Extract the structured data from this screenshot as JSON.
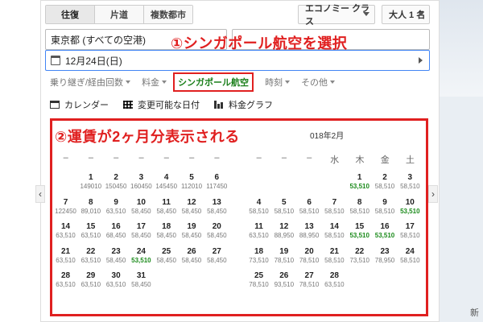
{
  "trip_tabs": [
    "往復",
    "片道",
    "複数都市"
  ],
  "cabin": "エコノミー クラス",
  "passengers": "大人 1 名",
  "origin": "東京都 (すべての空港)",
  "date": "12月24日(日)",
  "filters": [
    "乗り継ぎ/経由回数",
    "料金",
    "シンガポール航空",
    "時刻",
    "その他"
  ],
  "views": [
    "カレンダー",
    "変更可能な日付",
    "料金グラフ"
  ],
  "annotations": {
    "step1": "①シンガポール航空を選択",
    "step2": "②運賃が2ヶ月分表示される"
  },
  "calendar": {
    "right_month": "018年2月",
    "right_dow": [
      "水",
      "木",
      "金",
      "土"
    ],
    "left_days": [
      {
        "d": "1",
        "p": "149010"
      },
      {
        "d": "2",
        "p": "150450"
      },
      {
        "d": "3",
        "p": "160450"
      },
      {
        "d": "4",
        "p": "145450"
      },
      {
        "d": "5",
        "p": "112010"
      },
      {
        "d": "6",
        "p": "117450"
      },
      {
        "d": "7",
        "p": "122450"
      },
      {
        "d": "8",
        "p": "89,010"
      },
      {
        "d": "9",
        "p": "63,510"
      },
      {
        "d": "10",
        "p": "58,450"
      },
      {
        "d": "11",
        "p": "58,450"
      },
      {
        "d": "12",
        "p": "58,450"
      },
      {
        "d": "13",
        "p": "58,450"
      },
      {
        "d": "14",
        "p": "63,510"
      },
      {
        "d": "15",
        "p": "63,510"
      },
      {
        "d": "16",
        "p": "68,450"
      },
      {
        "d": "17",
        "p": "58,450"
      },
      {
        "d": "18",
        "p": "58,450"
      },
      {
        "d": "19",
        "p": "58,450"
      },
      {
        "d": "20",
        "p": "58,450"
      },
      {
        "d": "21",
        "p": "63,510"
      },
      {
        "d": "22",
        "p": "63,510"
      },
      {
        "d": "23",
        "p": "58,450"
      },
      {
        "d": "24",
        "p": "53,510",
        "low": true
      },
      {
        "d": "25",
        "p": "58,450"
      },
      {
        "d": "26",
        "p": "58,450"
      },
      {
        "d": "27",
        "p": "58,450"
      },
      {
        "d": "28",
        "p": "63,510"
      },
      {
        "d": "29",
        "p": "63,510"
      },
      {
        "d": "30",
        "p": "63,510"
      },
      {
        "d": "31",
        "p": "58,450"
      }
    ],
    "right_days": [
      {
        "d": "1",
        "p": "53,510",
        "low": true
      },
      {
        "d": "2",
        "p": "58,510"
      },
      {
        "d": "3",
        "p": "58,510"
      },
      {
        "d": "4",
        "p": "58,510"
      },
      {
        "d": "5",
        "p": "58,510"
      },
      {
        "d": "6",
        "p": "58,510"
      },
      {
        "d": "7",
        "p": "58,510"
      },
      {
        "d": "8",
        "p": "58,510"
      },
      {
        "d": "9",
        "p": "58,510"
      },
      {
        "d": "10",
        "p": "53,510",
        "low": true
      },
      {
        "d": "11",
        "p": "63,510"
      },
      {
        "d": "12",
        "p": "88,950"
      },
      {
        "d": "13",
        "p": "88,950"
      },
      {
        "d": "14",
        "p": "58,510"
      },
      {
        "d": "15",
        "p": "53,510",
        "low": true
      },
      {
        "d": "16",
        "p": "53,510",
        "low": true
      },
      {
        "d": "17",
        "p": "58,510"
      },
      {
        "d": "18",
        "p": "73,510"
      },
      {
        "d": "19",
        "p": "78,510"
      },
      {
        "d": "20",
        "p": "78,510"
      },
      {
        "d": "21",
        "p": "58,510"
      },
      {
        "d": "22",
        "p": "73,510"
      },
      {
        "d": "23",
        "p": "78,950"
      },
      {
        "d": "24",
        "p": "58,510"
      },
      {
        "d": "25",
        "p": "78,510"
      },
      {
        "d": "26",
        "p": "93,510"
      },
      {
        "d": "27",
        "p": "78,510"
      },
      {
        "d": "28",
        "p": "63,510"
      }
    ]
  },
  "side_text": "新"
}
